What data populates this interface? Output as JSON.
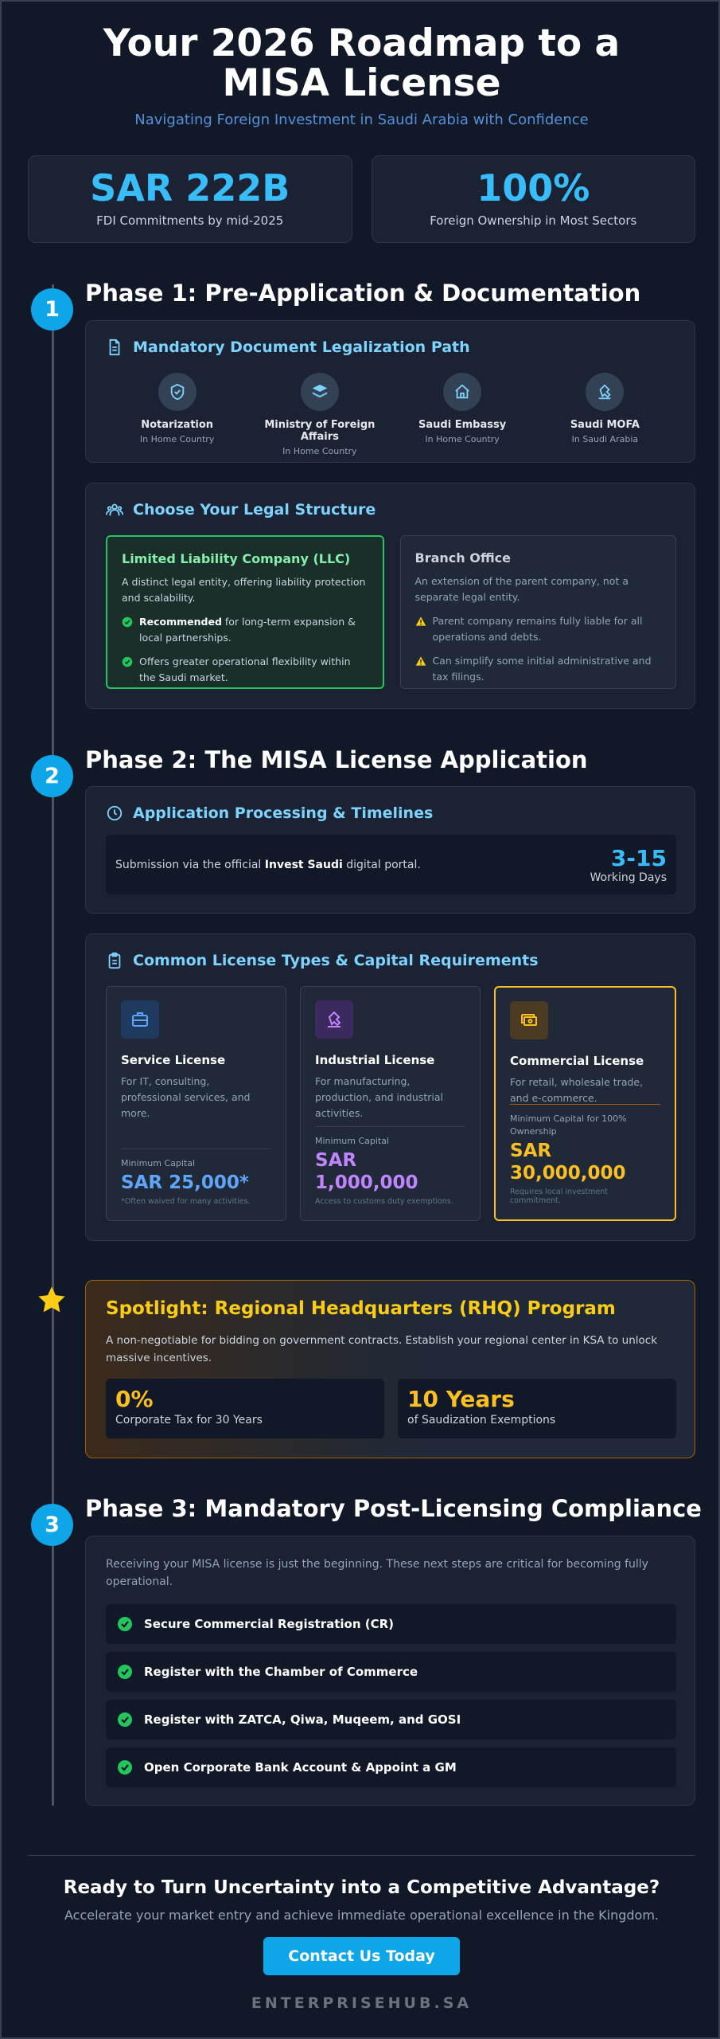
{
  "header": {
    "title": "Your 2026 Roadmap to a MISA License",
    "subtitle": "Navigating Foreign Investment in Saudi Arabia with Confidence"
  },
  "stats": [
    {
      "value": "SAR 222B",
      "label": "FDI Commitments by mid-2025"
    },
    {
      "value": "100%",
      "label": "Foreign Ownership in Most Sectors"
    }
  ],
  "phase1": {
    "number": "1",
    "title": "Phase 1: Pre-Application & Documentation",
    "legalization": {
      "heading": "Mandatory Document Legalization Path",
      "steps": [
        {
          "name": "Notarization",
          "location": "In Home Country",
          "icon": "shield-check-icon"
        },
        {
          "name": "Ministry of Foreign Affairs",
          "location": "In Home Country",
          "icon": "layers-icon"
        },
        {
          "name": "Saudi Embassy",
          "location": "In Home Country",
          "icon": "home-icon"
        },
        {
          "name": "Saudi MOFA",
          "location": "In Saudi Arabia",
          "icon": "stamp-icon"
        }
      ]
    },
    "structure": {
      "heading": "Choose Your Legal Structure",
      "llc": {
        "title": "Limited Liability Company (LLC)",
        "desc": "A distinct legal entity, offering liability protection and scalability.",
        "bullet1_strong": "Recommended",
        "bullet1_rest": " for long-term expansion & local partnerships.",
        "bullet2": "Offers greater operational flexibility within the Saudi market."
      },
      "branch": {
        "title": "Branch Office",
        "desc": "An extension of the parent company, not a separate legal entity.",
        "bullet1": "Parent company remains fully liable for all operations and debts.",
        "bullet2": "Can simplify some initial administrative and tax filings."
      }
    }
  },
  "phase2": {
    "number": "2",
    "title": "Phase 2: The MISA License Application",
    "processing": {
      "heading": "Application Processing & Timelines",
      "text_pre": "Submission via the official ",
      "text_strong": "Invest Saudi",
      "text_post": " digital portal.",
      "days": "3-15",
      "days_label": "Working Days"
    },
    "licenses": {
      "heading": "Common License Types & Capital Requirements",
      "items": [
        {
          "name": "Service License",
          "desc": "For IT, consulting, professional services, and more.",
          "cap_label": "Minimum Capital",
          "capital": "SAR 25,000*",
          "note": "*Often waived for many activities.",
          "color": "#60a5fa",
          "icon": "briefcase-icon"
        },
        {
          "name": "Industrial License",
          "desc": "For manufacturing, production, and industrial activities.",
          "cap_label": "Minimum Capital",
          "capital": "SAR 1,000,000",
          "note": "Access to customs duty exemptions.",
          "color": "#c084fc",
          "icon": "factory-icon"
        },
        {
          "name": "Commercial License",
          "desc": "For retail, wholesale trade, and e-commerce.",
          "cap_label": "Minimum Capital for 100% Ownership",
          "capital": "SAR 30,000,000",
          "note": "Requires local investment commitment.",
          "color": "#fbbf24",
          "icon": "cash-icon"
        }
      ]
    }
  },
  "spotlight": {
    "title": "Spotlight: Regional Headquarters (RHQ) Program",
    "desc": "A non-negotiable for bidding on government contracts. Establish your regional center in KSA to unlock massive incentives.",
    "stats": [
      {
        "value": "0%",
        "label": "Corporate Tax for 30 Years"
      },
      {
        "value": "10 Years",
        "label": "of Saudization Exemptions"
      }
    ]
  },
  "phase3": {
    "number": "3",
    "title": "Phase 3: Mandatory Post-Licensing Compliance",
    "intro": "Receiving your MISA license is just the beginning. These next steps are critical for becoming fully operational.",
    "items": [
      "Secure Commercial Registration (CR)",
      "Register with the Chamber of Commerce",
      "Register with ZATCA, Qiwa, Muqeem, and GOSI",
      "Open Corporate Bank Account & Appoint a GM"
    ]
  },
  "footer": {
    "cta_title": "Ready to Turn Uncertainty into a Competitive Advantage?",
    "cta_sub": "Accelerate your market entry and achieve immediate operational excellence in the Kingdom.",
    "button": "Contact Us Today",
    "brand": "ENTERPRISEHUB.SA"
  },
  "colors": {
    "background": "#111827",
    "accent": "#0ea5e9",
    "heading_accent": "#7dd3fc",
    "success": "#22c55e",
    "warning": "#fbbf24"
  }
}
